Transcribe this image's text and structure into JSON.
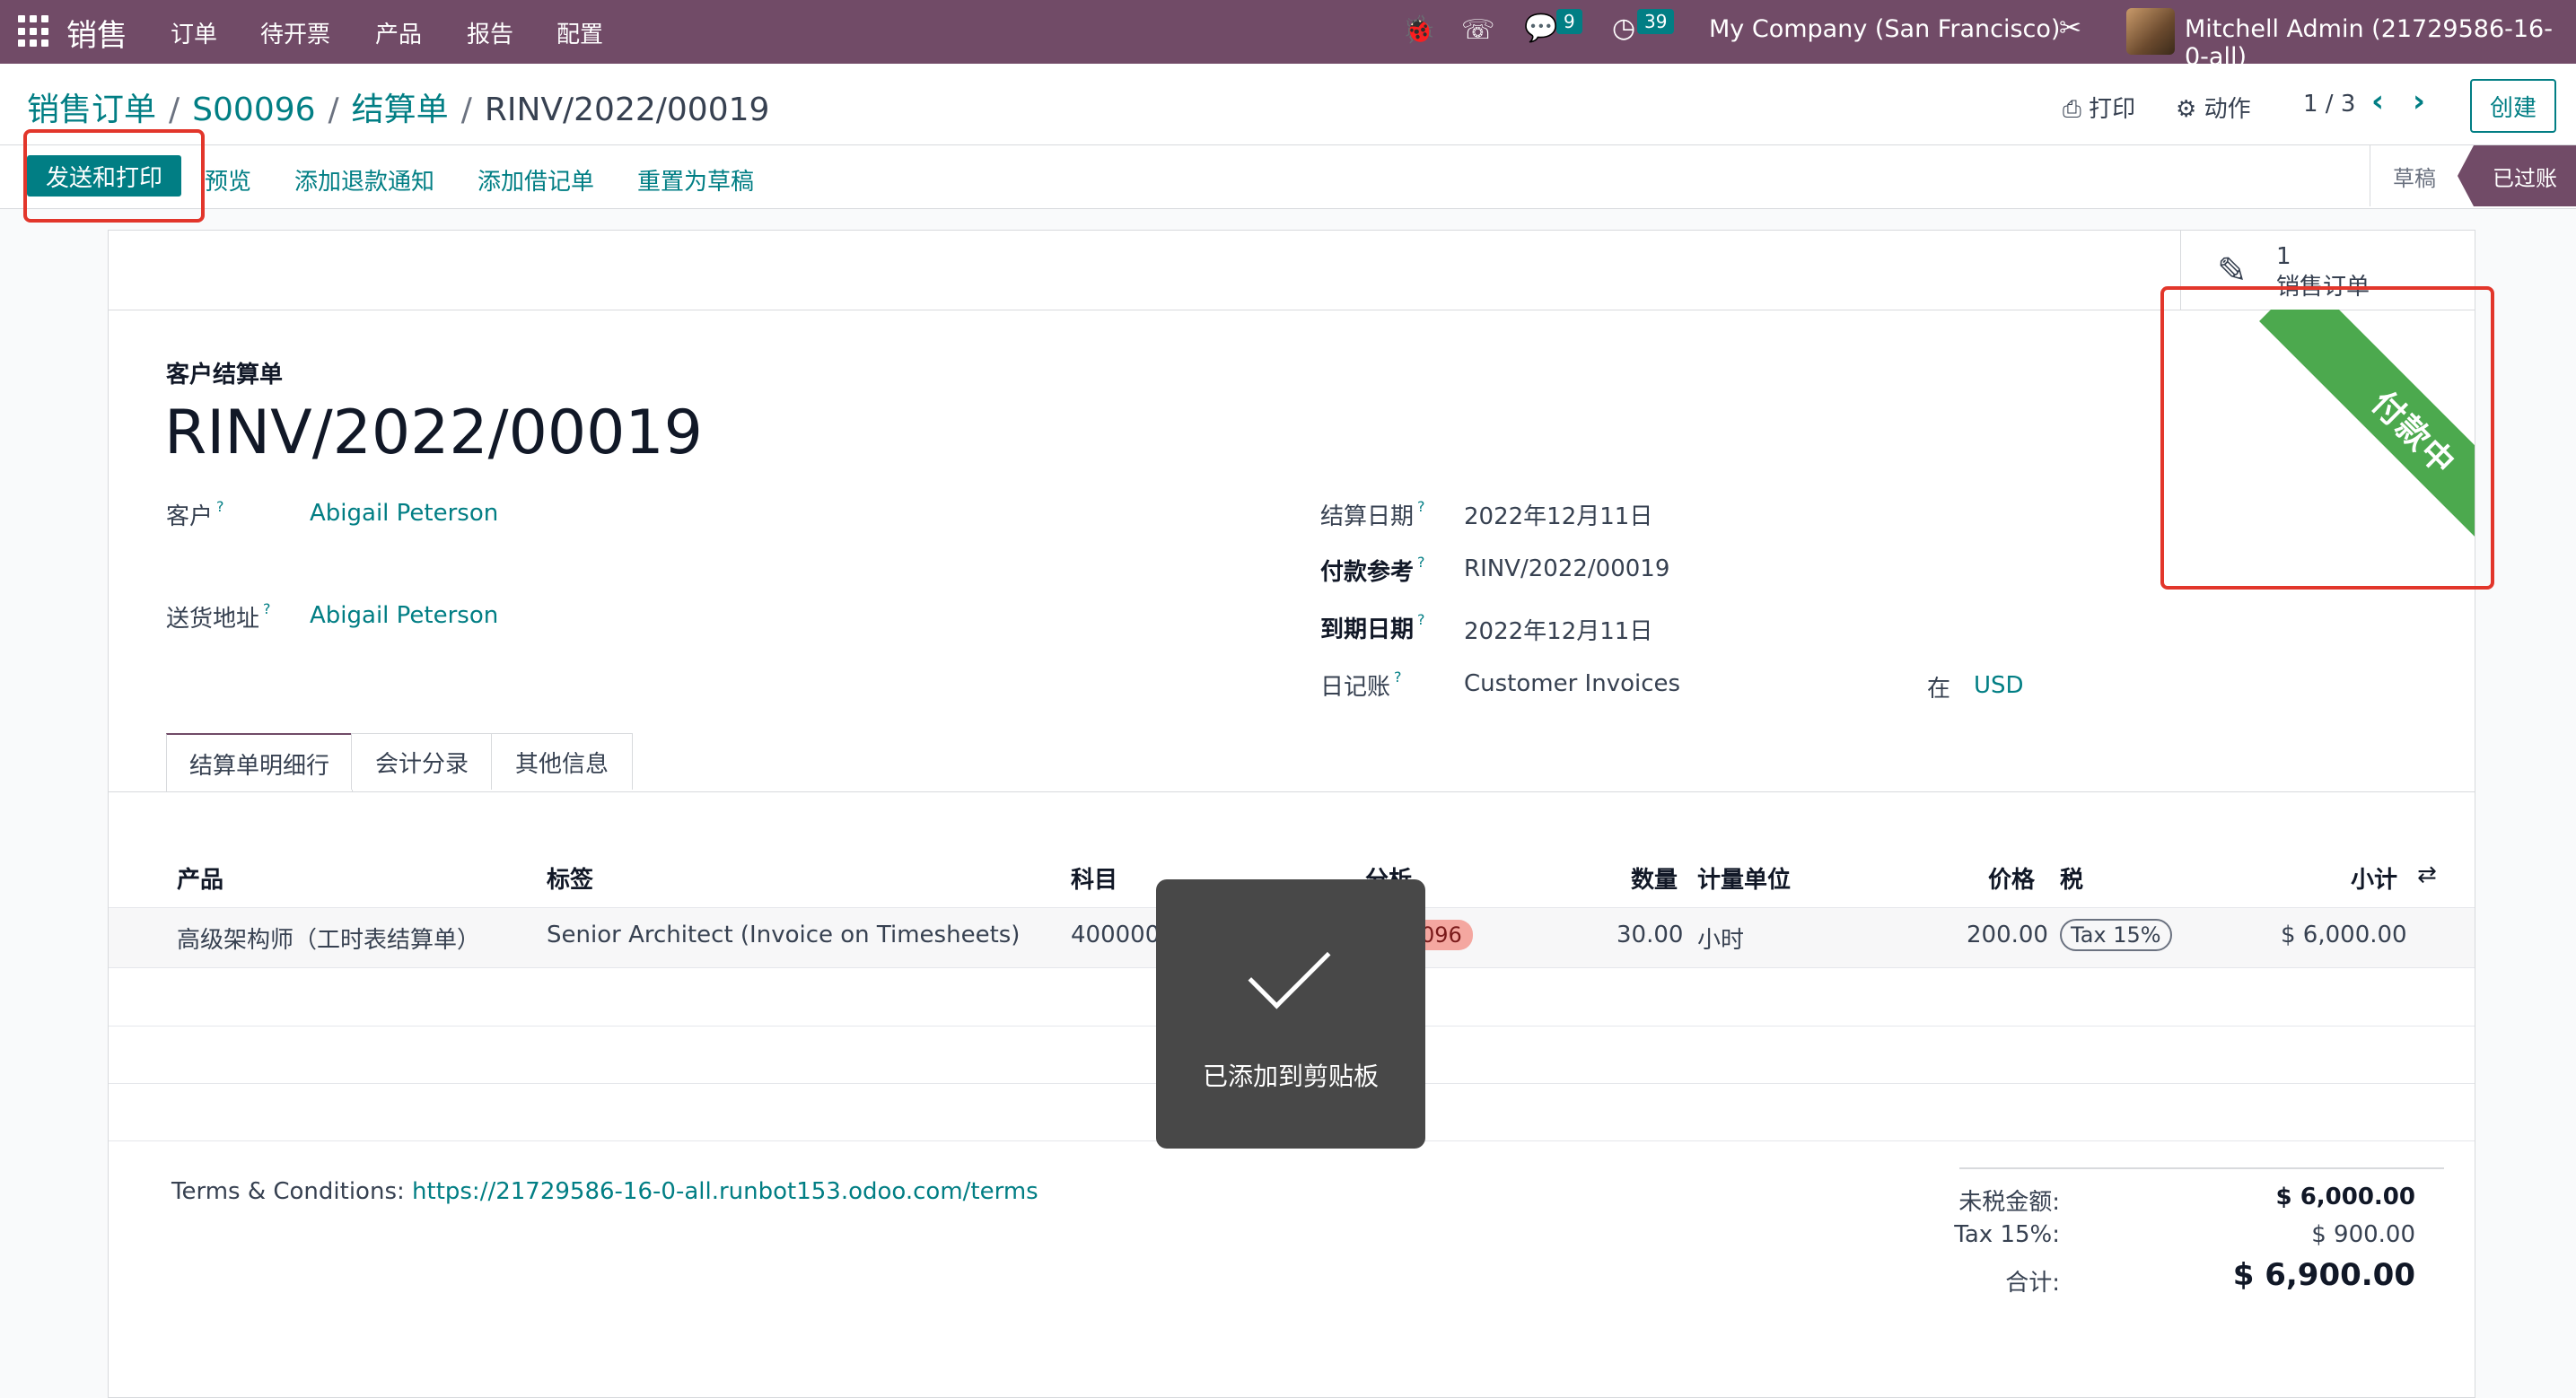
{
  "topnav": {
    "app_name": "销售",
    "menus": [
      "订单",
      "待开票",
      "产品",
      "报告",
      "配置"
    ],
    "messages_count": "9",
    "activities_count": "39",
    "company": "My Company (San Francisco)",
    "user": "Mitchell Admin (21729586-16-0-all)"
  },
  "breadcrumb": [
    "销售订单",
    "S00096",
    "结算单",
    "RINV/2022/00019"
  ],
  "control": {
    "print": "打印",
    "action": "动作",
    "pager": "1 / 3",
    "create": "创建"
  },
  "statusbar": {
    "send_print": "发送和打印",
    "buttons": [
      "预览",
      "添加退款通知",
      "添加借记单",
      "重置为草稿"
    ],
    "stages": [
      "草稿",
      "已过账"
    ]
  },
  "smart_button": {
    "value": "1",
    "label": "销售订单"
  },
  "ribbon": "付款中",
  "invoice": {
    "type_label": "客户结算单",
    "name": "RINV/2022/00019",
    "customer_label": "客户",
    "customer": "Abigail Peterson",
    "delivery_label": "送货地址",
    "delivery": "Abigail Peterson",
    "invoice_date_label": "结算日期",
    "invoice_date": "2022年12月11日",
    "payment_ref_label": "付款参考",
    "payment_ref": "RINV/2022/00019",
    "due_date_label": "到期日期",
    "due_date": "2022年12月11日",
    "journal_label": "日记账",
    "journal": "Customer Invoices",
    "in_label": "在",
    "currency": "USD"
  },
  "tabs": [
    "结算单明细行",
    "会计分录",
    "其他信息"
  ],
  "table": {
    "headers": [
      "产品",
      "标签",
      "科目",
      "分析",
      "数量",
      "计量单位",
      "价格",
      "税",
      "小计"
    ],
    "row": {
      "product": "高级架构师（工时表结算单）",
      "label": "Senior Architect (Invoice on Timesheets)",
      "account": "400000",
      "analytic": "096",
      "quantity": "30.00",
      "uom": "小时",
      "price": "200.00",
      "tax": "Tax 15%",
      "subtotal": "$ 6,000.00"
    }
  },
  "toast": "已添加到剪贴板",
  "terms": {
    "label": "Terms & Conditions: ",
    "url": "https://21729586-16-0-all.runbot153.odoo.com/terms"
  },
  "totals": {
    "untaxed_label": "未税金额:",
    "untaxed": "$ 6,000.00",
    "tax_label": "Tax 15%:",
    "tax": "$ 900.00",
    "total_label": "合计:",
    "total": "$ 6,900.00"
  },
  "colors": {
    "brand": "#714b67",
    "accent": "#017e84",
    "ribbon": "#4ca94e",
    "highlight": "#e2362b"
  }
}
